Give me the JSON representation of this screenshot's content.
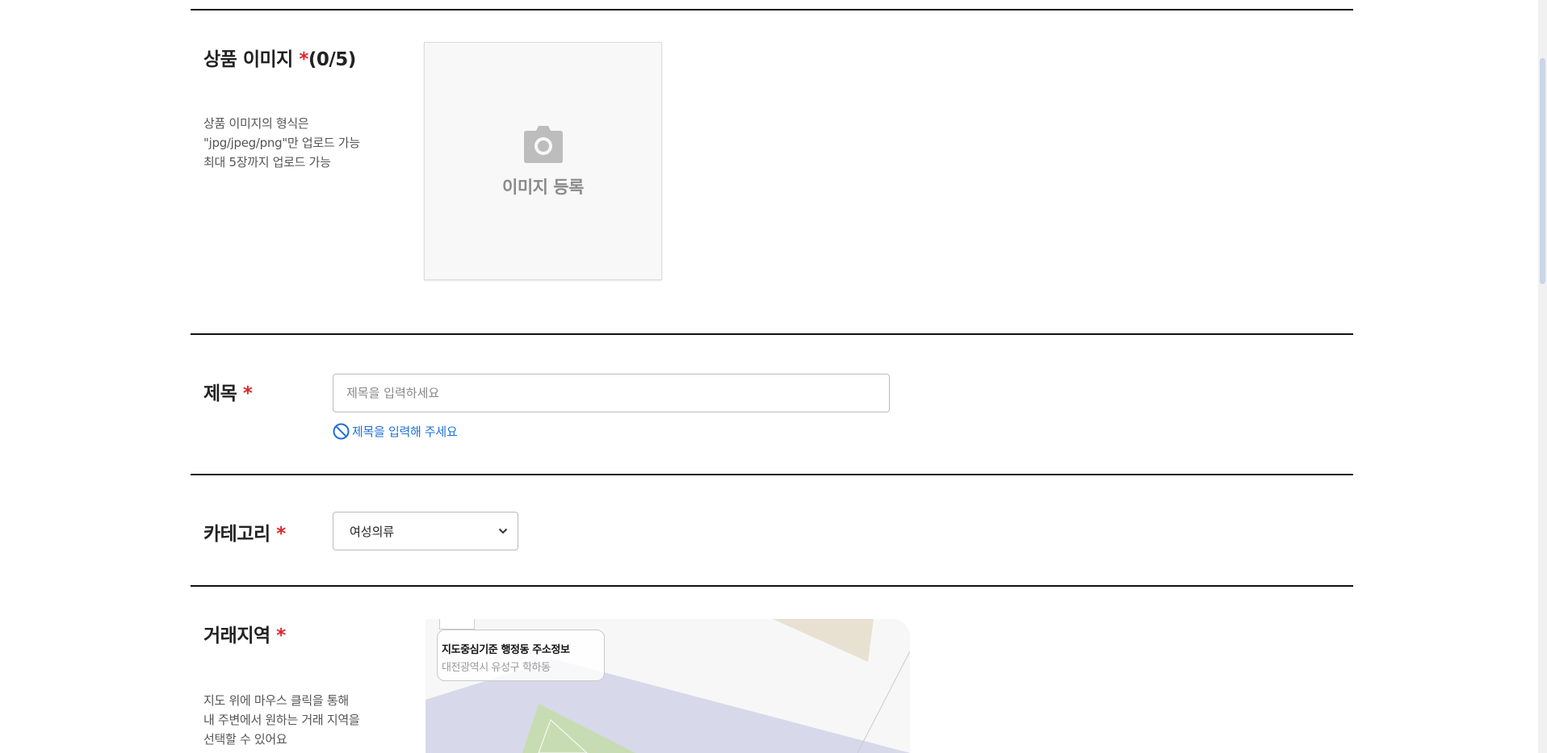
{
  "image_section": {
    "label": "상품 이미지",
    "required_mark": "*",
    "count": "(0/5)",
    "desc_lines": [
      "상품 이미지의 형식은",
      "\"jpg/jpeg/png\"만 업로드 가능",
      "최대 5장까지 업로드 가능"
    ],
    "upload_label": "이미지 등록",
    "upload_icon": "camera-icon"
  },
  "title_section": {
    "label": "제목",
    "required_mark": "*",
    "placeholder": "제목을 입력하세요",
    "value": "",
    "warning_icon": "no-entry-icon",
    "warning_text": "제목을 입력해 주세요"
  },
  "category_section": {
    "label": "카테고리",
    "required_mark": "*",
    "selected": "여성의류"
  },
  "region_section": {
    "label": "거래지역",
    "required_mark": "*",
    "desc_lines": [
      "지도 위에 마우스 클릭을 통해",
      "내 주변에서 원하는 거래 지역을",
      "선택할 수 있어요"
    ],
    "map_info_title": "지도중심기준 행정동 주소정보",
    "map_info_address": "대전광역시 유성구 학하동"
  },
  "colors": {
    "required": "#e0262b",
    "warning": "#1f6fd6",
    "divider": "#111111"
  }
}
